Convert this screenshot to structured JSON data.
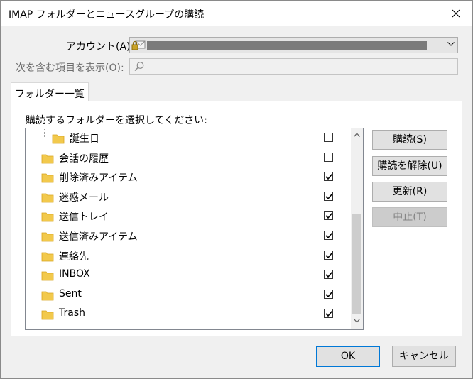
{
  "window": {
    "title": "IMAP フォルダーとニュースグループの購読"
  },
  "account": {
    "label": "アカウント(A):"
  },
  "filter": {
    "label": "次を含む項目を表示(O):",
    "value": ""
  },
  "tab": {
    "label": "フォルダー一覧(L)"
  },
  "list": {
    "label": "購読するフォルダーを選択してください:",
    "folders": [
      {
        "name": "誕生日",
        "subscribed": false,
        "indent": 1
      },
      {
        "name": "会話の履歴",
        "subscribed": false,
        "indent": 0
      },
      {
        "name": "削除済みアイテム",
        "subscribed": true,
        "indent": 0
      },
      {
        "name": "迷惑メール",
        "subscribed": true,
        "indent": 0
      },
      {
        "name": "送信トレイ",
        "subscribed": true,
        "indent": 0
      },
      {
        "name": "送信済みアイテム",
        "subscribed": true,
        "indent": 0
      },
      {
        "name": "連絡先",
        "subscribed": true,
        "indent": 0
      },
      {
        "name": "INBOX",
        "subscribed": true,
        "indent": 0
      },
      {
        "name": "Sent",
        "subscribed": true,
        "indent": 0
      },
      {
        "name": "Trash",
        "subscribed": true,
        "indent": 0
      }
    ]
  },
  "actions": {
    "subscribe": "購読(S)",
    "unsubscribe": "購読を解除(U)",
    "refresh": "更新(R)",
    "stop": "中止(T)"
  },
  "footer": {
    "ok": "OK",
    "cancel": "キャンセル"
  },
  "colors": {
    "folder": "#f2c94c",
    "accent": "#0078d7"
  }
}
